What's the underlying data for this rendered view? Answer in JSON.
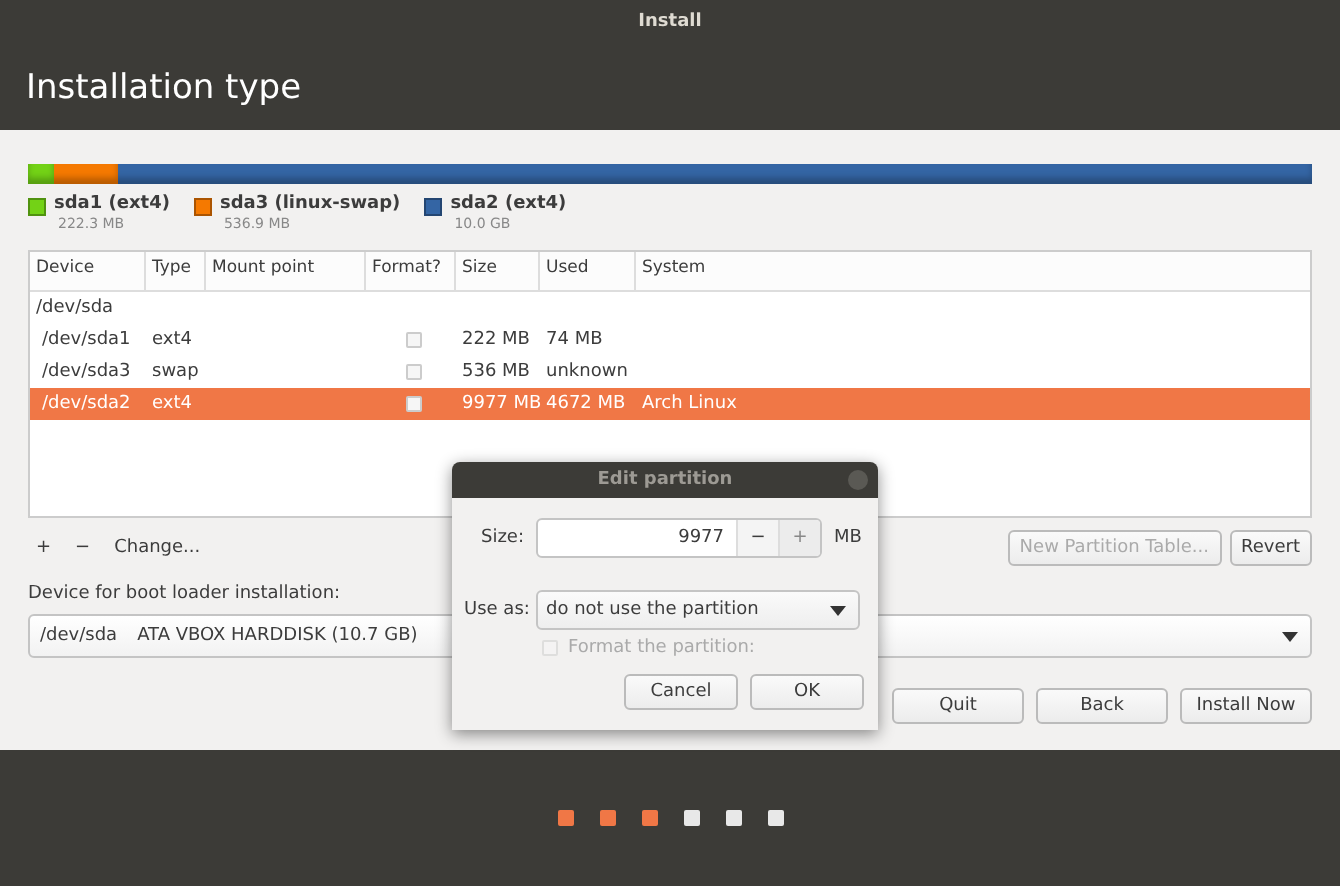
{
  "window": {
    "title": "Install"
  },
  "page_title": "Installation type",
  "partition_bar": [
    {
      "color": "#73d216",
      "level": 0.02
    },
    {
      "color": "#f57900",
      "level": 0.07
    },
    {
      "color": "#3465a4",
      "level": 1
    }
  ],
  "legend": [
    {
      "name": "sda1 (ext4)",
      "size": "222.3 MB",
      "color": "#73d216"
    },
    {
      "name": "sda3 (linux-swap)",
      "size": "536.9 MB",
      "color": "#f57900"
    },
    {
      "name": "sda2 (ext4)",
      "size": "10.0 GB",
      "color": "#3465a4"
    }
  ],
  "table": {
    "columns": [
      "Device",
      "Type",
      "Mount point",
      "Format?",
      "Size",
      "Used",
      "System"
    ],
    "rows": [
      {
        "kind": "disk",
        "device": "/dev/sda",
        "selected": false
      },
      {
        "kind": "partition",
        "device": "/dev/sda1",
        "type": "ext4",
        "mount": "",
        "format": false,
        "size": "222 MB",
        "used": "74 MB",
        "system": "",
        "selected": false
      },
      {
        "kind": "partition",
        "device": "/dev/sda3",
        "type": "swap",
        "mount": "",
        "format": false,
        "size": "536 MB",
        "used": "unknown",
        "system": "",
        "selected": false
      },
      {
        "kind": "partition",
        "device": "/dev/sda2",
        "type": "ext4",
        "mount": "",
        "format": false,
        "size": "9977 MB",
        "used": "4672 MB",
        "system": "Arch Linux",
        "selected": true
      }
    ]
  },
  "toolbar": {
    "add": "+",
    "remove": "−",
    "change": "Change...",
    "new_table": "New Partition Table...",
    "revert": "Revert"
  },
  "boot_loader": {
    "label": "Device for boot loader installation:",
    "device": "/dev/sda",
    "description": "ATA VBOX HARDDISK (10.7 GB)"
  },
  "buttons": [
    "Quit",
    "Back",
    "Install Now"
  ],
  "dialog": {
    "title": "Edit partition",
    "size_label": "Size:",
    "size_value": "9977",
    "minus": "−",
    "plus": "+",
    "unit": "MB",
    "use_as_label": "Use as:",
    "use_as_value": "do not use the partition",
    "format_label": "Format the partition:",
    "format_checked": false,
    "format_disabled": true,
    "buttons": [
      "Cancel",
      "OK"
    ]
  },
  "progress_dots": [
    {
      "done": true
    },
    {
      "done": true
    },
    {
      "done": true
    },
    {
      "done": false
    },
    {
      "done": false
    },
    {
      "done": false
    }
  ]
}
